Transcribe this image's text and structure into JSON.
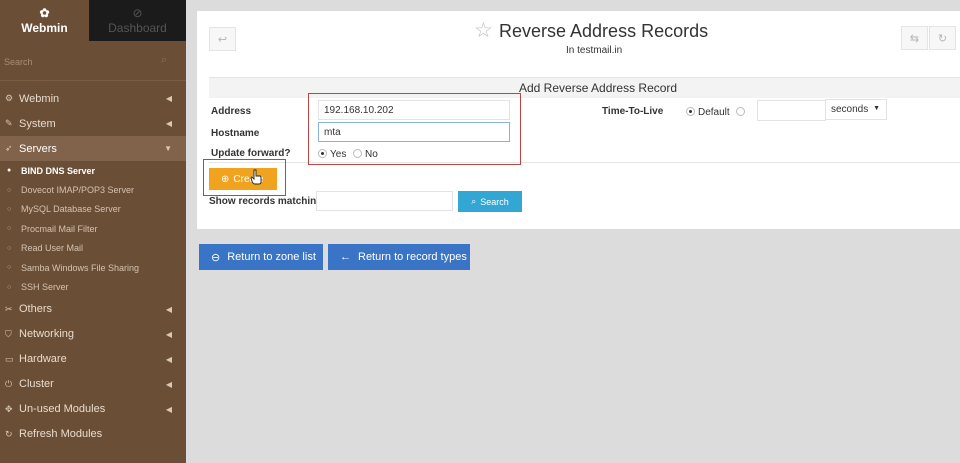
{
  "sidebar": {
    "tabs": {
      "webmin": "Webmin",
      "dashboard": "Dashboard"
    },
    "search_placeholder": "Search",
    "categories": {
      "webmin": "Webmin",
      "system": "System",
      "servers": "Servers",
      "others": "Others",
      "networking": "Networking",
      "hardware": "Hardware",
      "cluster": "Cluster",
      "unused": "Un-used Modules",
      "refresh": "Refresh Modules"
    },
    "servers_items": [
      "BIND DNS Server",
      "Dovecot IMAP/POP3 Server",
      "MySQL Database Server",
      "Procmail Mail Filter",
      "Read User Mail",
      "Samba Windows File Sharing",
      "SSH Server"
    ]
  },
  "header": {
    "title": "Reverse Address Records",
    "subtitle": "In testmail.in"
  },
  "form": {
    "title": "Add Reverse Address Record",
    "address_label": "Address",
    "address_value": "192.168.10.202",
    "hostname_label": "Hostname",
    "hostname_value": "mta",
    "update_label": "Update forward?",
    "yes": "Yes",
    "no": "No",
    "ttl_label": "Time-To-Live",
    "ttl_default": "Default",
    "ttl_unit": "seconds"
  },
  "actions": {
    "create": "Create",
    "show_label": "Show records matching:",
    "search": "Search",
    "return_zone": "Return to zone list",
    "return_types": "Return to record types"
  },
  "colors": {
    "sidebar": "#6b4e36",
    "create": "#f0a31f",
    "search": "#32a7d3",
    "return": "#3a74c6",
    "highlight": "#bb4444"
  }
}
